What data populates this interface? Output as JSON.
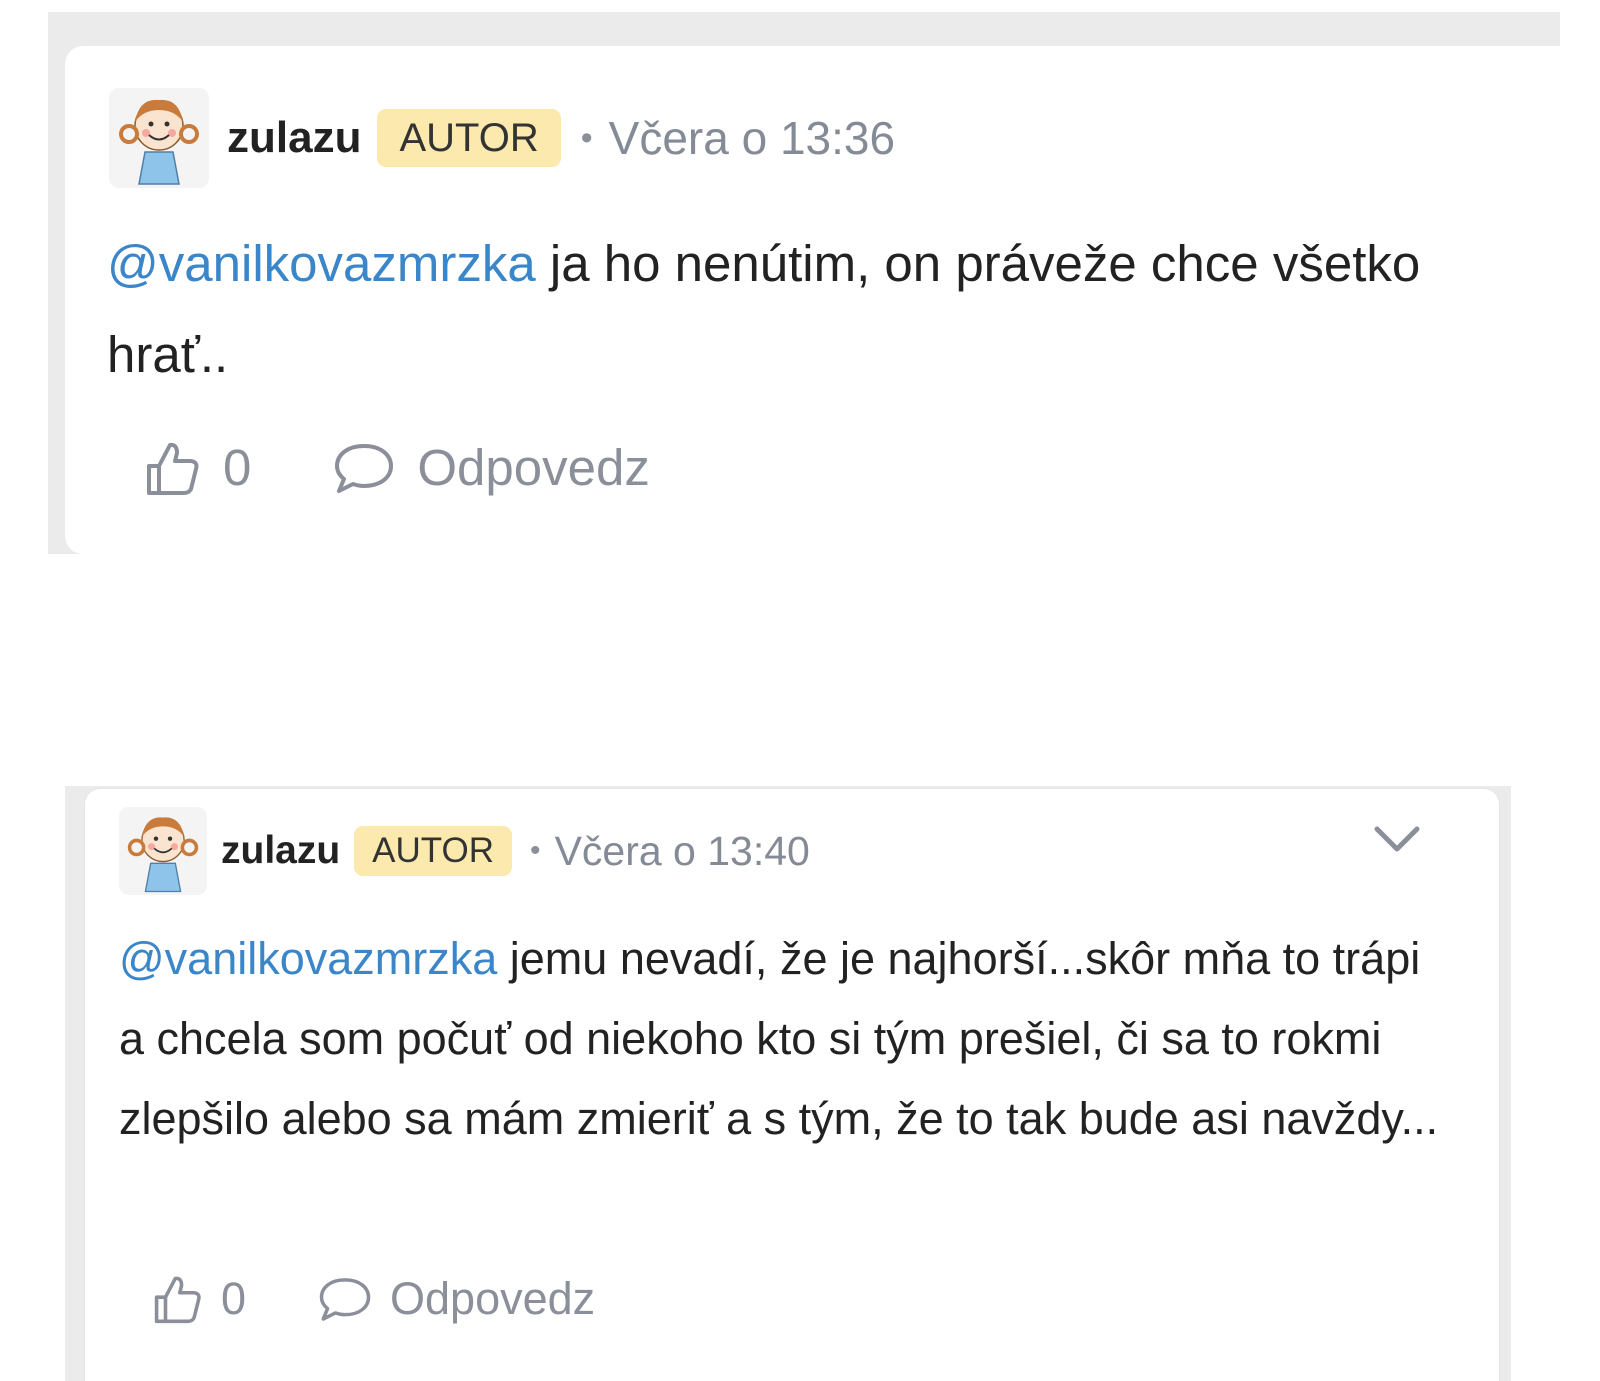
{
  "comments": [
    {
      "username": "zulazu",
      "badge": "AUTOR",
      "separator": "•",
      "timestamp": "Včera o 13:36",
      "mention": "@vanilkovazmrzka",
      "text": " ja ho nenútim, on práveže chce všetko hrať..",
      "likes": "0",
      "reply_label": "Odpovedz",
      "has_menu_chevron": false
    },
    {
      "username": "zulazu",
      "badge": "AUTOR",
      "separator": "•",
      "timestamp": "Včera o 13:40",
      "mention": "@vanilkovazmrzka",
      "text": " jemu nevadí, že je najhorší...skôr mňa to trápi a chcela som počuť od niekoho kto si tým prešiel, či sa to rokmi zlepšilo alebo sa mám zmieriť a s tým, že to tak bude asi navždy...",
      "likes": "0",
      "reply_label": "Odpovedz",
      "has_menu_chevron": true
    }
  ],
  "colors": {
    "mention": "#3a86c8",
    "badge_bg": "#fbe9ad",
    "meta_gray": "#858b96",
    "frame_gray": "#ebebeb"
  },
  "icons": {
    "avatar": "cartoon-girl-avatar",
    "like": "thumbs-up-icon",
    "reply": "speech-bubble-icon",
    "menu": "chevron-down-icon"
  }
}
